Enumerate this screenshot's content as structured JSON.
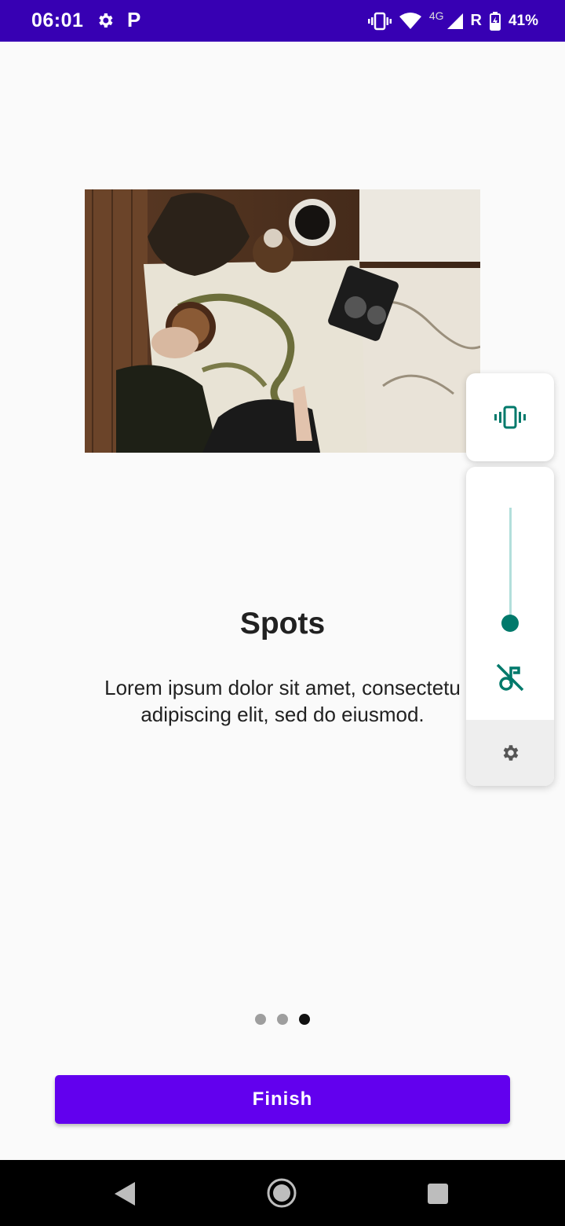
{
  "status_bar": {
    "time": "06:01",
    "app_letter": "P",
    "network": "4G",
    "roaming": "R",
    "battery": "41%",
    "icons": [
      "settings-icon",
      "vibrate-icon",
      "wifi-icon",
      "signal-icon",
      "battery-icon"
    ]
  },
  "onboarding": {
    "image_icon": "map-photo",
    "title": "Spots",
    "description": "Lorem ipsum dolor sit amet, consectetu\nadipiscing elit, sed do eiusmod.",
    "page_count": 3,
    "active_page": 3,
    "finish_label": "Finish"
  },
  "volume_panel": {
    "mode_icon": "vibrate-icon",
    "level": 0,
    "mute_icon": "music-off-icon",
    "settings_icon": "gear-icon",
    "accent_color": "#00796b"
  },
  "colors": {
    "status_bar": "#3700b3",
    "primary": "#6200ee",
    "background": "#fafafa"
  },
  "nav_bar": {
    "icons": [
      "back-icon",
      "home-icon",
      "recents-icon"
    ]
  }
}
